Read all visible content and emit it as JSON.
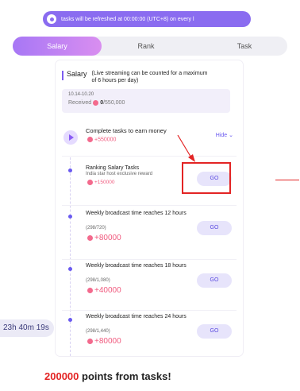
{
  "notice": {
    "text": "tasks will be refreshed at 00:00:00 (UTC+8) on every l"
  },
  "tabs": [
    {
      "label": "Salary",
      "active": true
    },
    {
      "label": "Rank",
      "active": false
    },
    {
      "label": "Task",
      "active": false
    }
  ],
  "salary": {
    "title": "Salary",
    "note": "(Live streaming can be counted for a maximum of 6 hours per day)",
    "dates": "10.14-10.20",
    "received_label": "Received",
    "received_value": "0",
    "received_total": "/550,000"
  },
  "tasks_header": {
    "title": "Complete tasks to earn money",
    "reward": "+550000",
    "hide_label": "Hide"
  },
  "tasks": [
    {
      "title": "Ranking Salary Tasks",
      "sub": "India star host exclusive reward",
      "reward": "+150000",
      "button": "GO"
    },
    {
      "title": "Weekly broadcast time reaches 12 hours",
      "sub": "(298/720)",
      "reward": "+80000",
      "button": "GO"
    },
    {
      "title": "Weekly broadcast time reaches 18 hours",
      "sub": "(298/1,080)",
      "reward": "+40000",
      "button": "GO"
    },
    {
      "title": "Weekly broadcast time reaches 24 hours",
      "sub": "(298/1,440)",
      "reward": "+80000",
      "button": "GO"
    }
  ],
  "timer": "23h 40m 19s",
  "caption": {
    "number": "200000",
    "text": " points from tasks!"
  },
  "colors": {
    "accent": "#7c5cf0",
    "reward": "#f05a7e",
    "highlight": "#e32424"
  }
}
